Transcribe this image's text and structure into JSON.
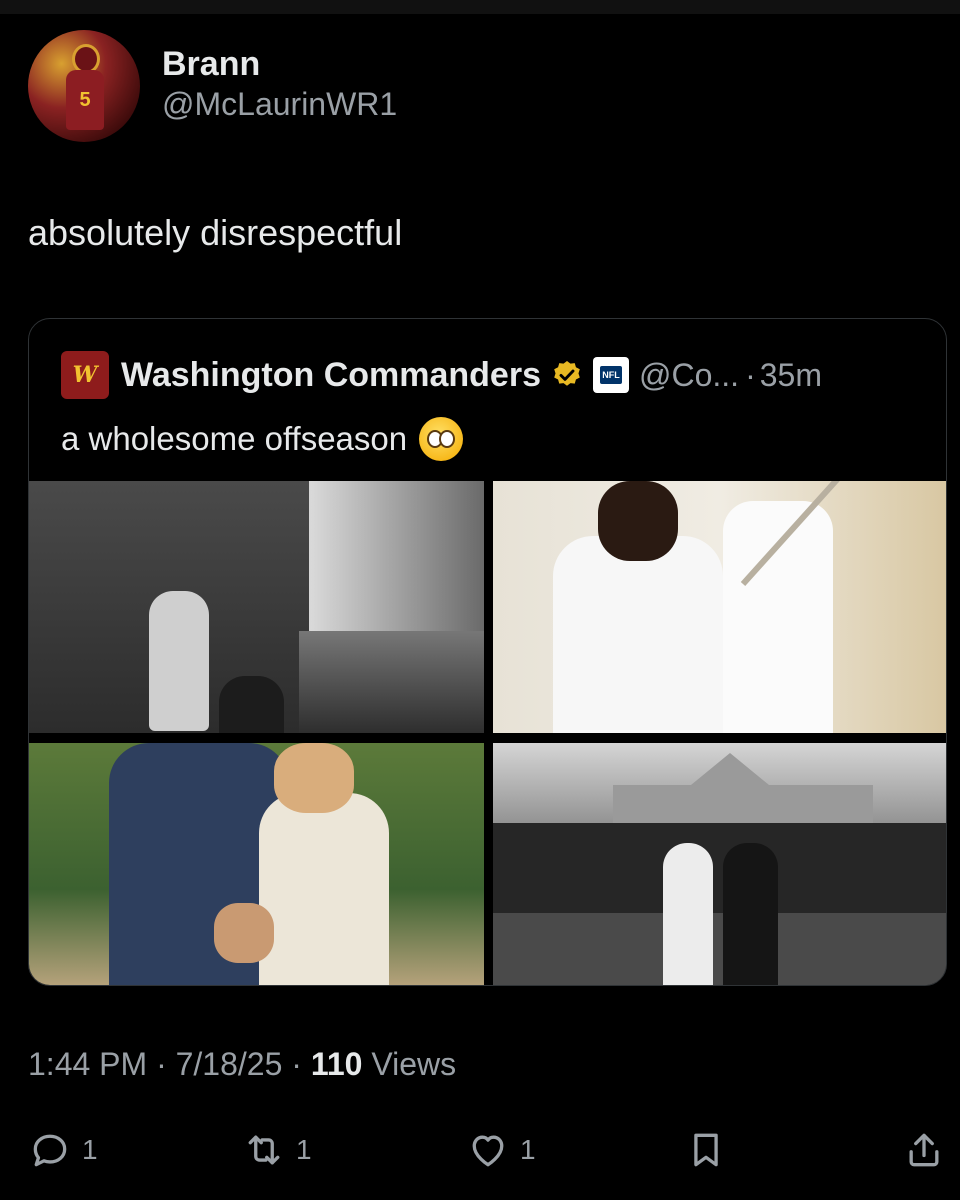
{
  "author": {
    "display_name": "Brann",
    "handle": "@McLaurinWR1",
    "avatar_number": "5"
  },
  "tweet": {
    "text": "absolutely disrespectful"
  },
  "quoted": {
    "logo_text": "W",
    "name": "Washington Commanders",
    "nfl_badge": "NFL",
    "handle": "@Co...",
    "separator": "·",
    "time": "35m",
    "text": "a wholesome offseason",
    "emoji": "pleading-face-emoji",
    "images": [
      {
        "name": "photo-proposal-lake",
        "style": "black-and-white"
      },
      {
        "name": "photo-couple-staircase",
        "style": "color"
      },
      {
        "name": "photo-ring-reveal",
        "style": "color"
      },
      {
        "name": "photo-wedding-walk",
        "style": "black-and-white"
      }
    ]
  },
  "meta": {
    "time": "1:44 PM",
    "sep1": "·",
    "date": "7/18/25",
    "sep2": "·",
    "views_count": "110",
    "views_label": "Views"
  },
  "actions": {
    "reply_count": "1",
    "retweet_count": "1",
    "like_count": "1"
  },
  "colors": {
    "background": "#000000",
    "text": "#e7e9ea",
    "muted": "#9aa0a6",
    "border": "#2f3336",
    "verified": "#e8b923",
    "commanders": "#8e1c1c"
  }
}
